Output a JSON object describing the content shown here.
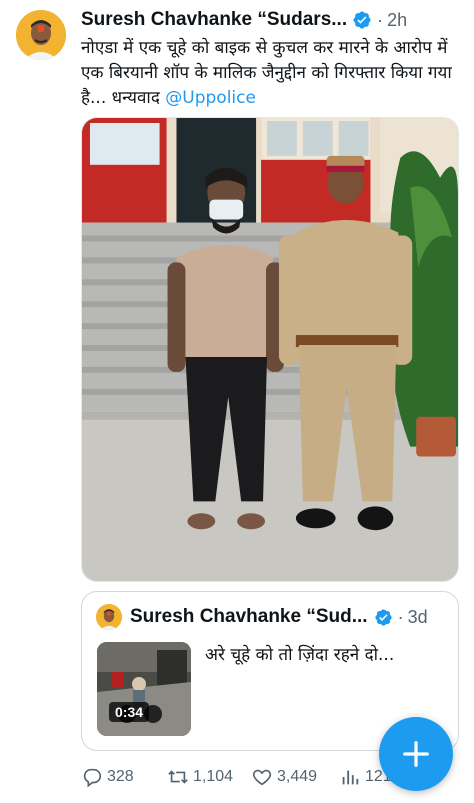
{
  "tweet": {
    "author": "Suresh Chavhanke “Sudars...",
    "time": "2h",
    "separator": "·",
    "text": "नोएडा में एक चूहे को बाइक से कुचल कर मारने के आरोप में एक बिरयानी शॉप के मालिक जैनुद्दीन को गिरफ्तार किया गया है... धन्यवाद ",
    "mention": "@Uppolice",
    "avatar_icon": "profile-avatar",
    "verified_icon": "verified-badge-icon",
    "colors": {
      "accent": "#1d9bf0",
      "text": "#0f1419",
      "muted": "#536471"
    }
  },
  "quoted": {
    "author": "Suresh Chavhanke “Sud...",
    "time": "3d",
    "separator": "·",
    "text": "अरे चूहे को तो ज़िंदा रहने दो...",
    "video_duration": "0:34"
  },
  "actions": {
    "replies": "328",
    "retweets": "1,104",
    "likes": "3,449",
    "views": "121"
  },
  "fab": {
    "icon": "plus-icon"
  }
}
